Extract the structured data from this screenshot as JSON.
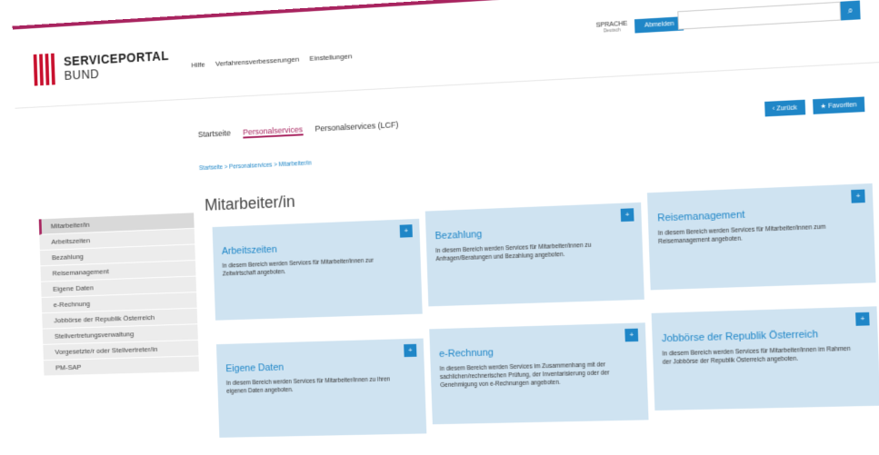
{
  "header": {
    "logo_line1": "SERVICEPORTAL",
    "logo_line2": "BUND",
    "nav": [
      "Hilfe",
      "Verfahrensverbesserungen",
      "Einstellungen"
    ],
    "lang_top": "SPRACHE",
    "lang_bottom": "Deutsch",
    "logout": "Abmelden",
    "search_placeholder": ""
  },
  "tabs": [
    "Startseite",
    "Personalservices",
    "Personalservices (LCF)"
  ],
  "actions": {
    "back": "‹ Zurück",
    "favorites": "★ Favoriten"
  },
  "breadcrumb": "Startseite > Personalservices > Mitarbeiter/in",
  "sidebar": [
    "Mitarbeiter/in",
    "Arbeitszeiten",
    "Bezahlung",
    "Reisemanagement",
    "Eigene Daten",
    "e-Rechnung",
    "Jobbörse der Republik Österreich",
    "Stellvertretungsverwaltung",
    "Vorgesetzte/r oder Stellvertreter/in",
    "PM-SAP"
  ],
  "page_title": "Mitarbeiter/in",
  "cards": [
    {
      "title": "Arbeitszeiten",
      "desc": "In diesem Bereich werden Services für Mitarbeiter/innen zur Zeitwirtschaft angeboten."
    },
    {
      "title": "Bezahlung",
      "desc": "In diesem Bereich werden Services für Mitarbeiter/innen zu Anfragen/Beratungen und Bezahlung angeboten."
    },
    {
      "title": "Reisemanagement",
      "desc": "In diesem Bereich werden Services für Mitarbeiter/innen zum Reisemanagement angeboten."
    },
    {
      "title": "Eigene Daten",
      "desc": "In diesem Bereich werden Services für Mitarbeiter/innen zu ihren eigenen Daten angeboten."
    },
    {
      "title": "e-Rechnung",
      "desc": "In diesem Bereich werden Services im Zusammenhang mit der sachlichen/rechnerischen Prüfung, der Inventarisierung oder der Genehmigung von e-Rechnungen angeboten."
    },
    {
      "title": "Jobbörse der Republik Österreich",
      "desc": "In diesem Bereich werden Services für Mitarbeiter/innen im Rahmen der Jobbörse der Republik Österreich angeboten."
    }
  ],
  "colors": {
    "brand": "#a8245f",
    "accent": "#1f86c7",
    "card_bg": "#cfe3f1"
  }
}
